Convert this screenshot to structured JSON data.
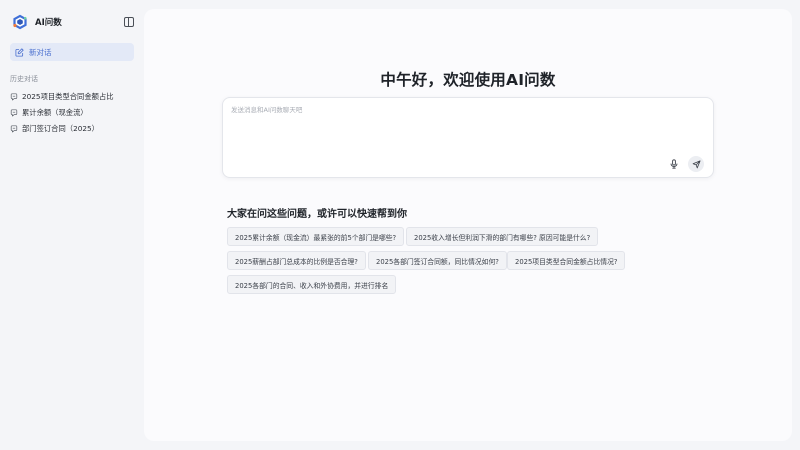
{
  "app": {
    "name": "AI问数"
  },
  "sidebar": {
    "new_chat_label": "新对话",
    "history_title": "历史对话",
    "history": [
      {
        "label": "2025项目类型合同金额占比"
      },
      {
        "label": "累计余额（现金流）"
      },
      {
        "label": "部门签订合同（2025）"
      }
    ]
  },
  "main": {
    "greeting": "中午好，欢迎使用AI问数",
    "input": {
      "placeholder": "发送消息和AI问数聊天吧",
      "value": ""
    },
    "suggestions_title": "大家在问这些问题，或许可以快速帮到你",
    "suggestions": [
      {
        "label": "2025累计余额（现金流）最紧张的前5个部门是哪些?"
      },
      {
        "label": "2025收入增长但利润下滑的部门有哪些? 原因可能是什么?"
      },
      {
        "label": "2025薪酬占部门总成本的比例是否合理?"
      },
      {
        "label": "2025各部门签订合同额，同比情况如何?"
      },
      {
        "label": "2025项目类型合同金额占比情况?"
      },
      {
        "label": "2025各部门的合同、收入和外协费用，并进行排名"
      }
    ]
  },
  "icons": {
    "logo": "logo-icon",
    "collapse": "sidebar-toggle-icon",
    "new_chat": "edit-icon",
    "history_item": "chat-bubble-icon",
    "mic": "microphone-icon",
    "send": "send-icon"
  },
  "colors": {
    "accent": "#4a6fcf",
    "accent_bg": "#e3e9f7",
    "page_bg": "#f4f5f8",
    "panel_bg": "#fbfbfd"
  }
}
